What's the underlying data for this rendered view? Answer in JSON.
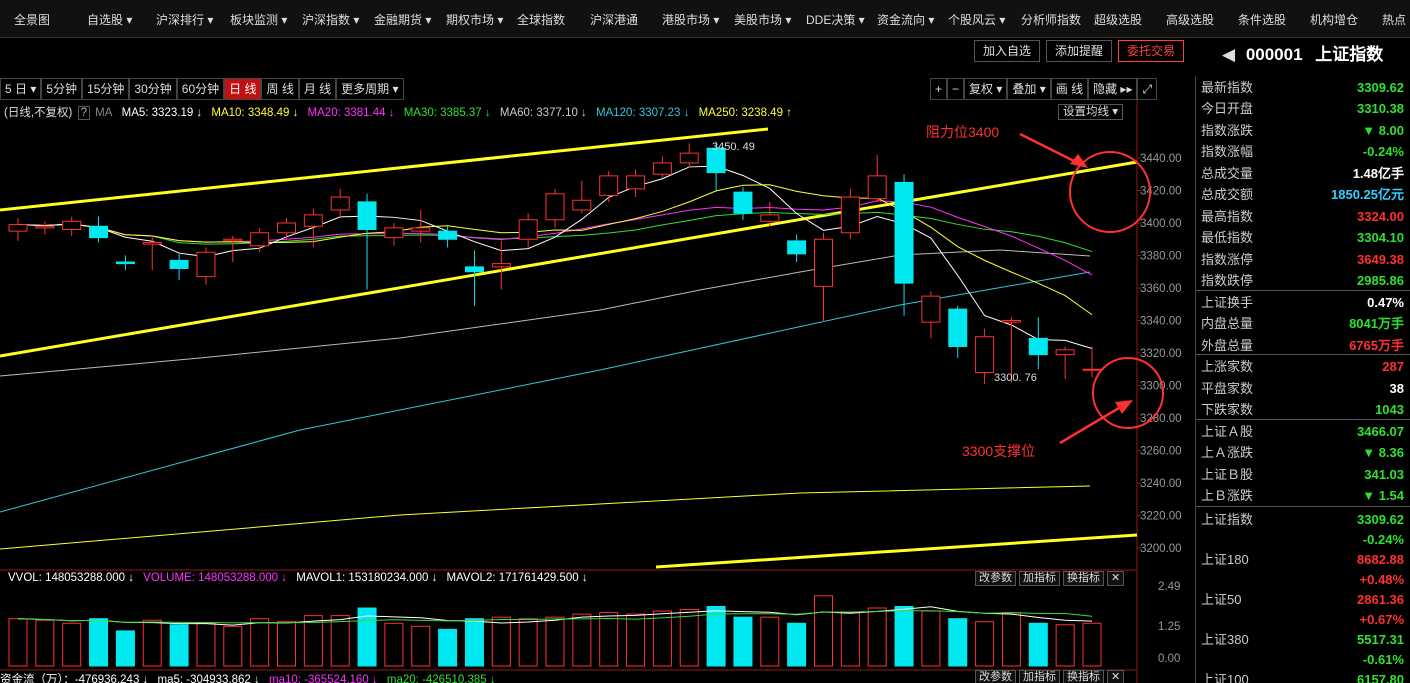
{
  "nav": [
    "全景图",
    "自选股 ▾",
    "沪深排行 ▾",
    "板块监测 ▾",
    "沪深指数 ▾",
    "金融期货 ▾",
    "期权市场 ▾",
    "全球指数",
    "沪深港通",
    "港股市场 ▾",
    "美股市场 ▾",
    "DDE决策 ▾",
    "资金流向 ▾",
    "个股风云 ▾",
    "分析师指数",
    "超级选股",
    "高级选股",
    "条件选股",
    "机构增仓",
    "热点"
  ],
  "actions": {
    "add_watch": "加入自选",
    "add_alert": "添加提醒",
    "trade": "委托交易"
  },
  "stock": {
    "code": "000001",
    "name": "上证指数"
  },
  "periods": [
    "5 日 ▾",
    "5分钟",
    "15分钟",
    "30分钟",
    "60分钟",
    "日 线",
    "周 线",
    "月 线",
    "更多周期 ▾"
  ],
  "tools": [
    "+",
    "−",
    "复权 ▾",
    "叠加 ▾",
    "画 线",
    "隐藏 ▸▸",
    "⤢"
  ],
  "ma_labels": {
    "mode": "(日线,不复权)",
    "q": "?",
    "ma": "MA",
    "ma5": "MA5: 3323.19 ↓",
    "ma10": "MA10: 3348.49 ↓",
    "ma20": "MA20: 3381.44 ↓",
    "ma30": "MA30: 3385.37 ↓",
    "ma60": "MA60: 3377.10 ↓",
    "ma120": "MA120: 3307.23 ↓",
    "ma250": "MA250: 3238.49 ↑",
    "setma": "设置均线 ▾"
  },
  "colors": {
    "up": "#ff3030",
    "down": "#00e8f0",
    "ma5": "#ffffff",
    "ma10": "#ffff30",
    "ma20": "#ff30ff",
    "ma30": "#30e030",
    "ma60": "#bbbbbb",
    "ma120": "#30c8e0",
    "ma250": "#ffff30",
    "trend": "#ffff20",
    "annot": "#ff3030"
  },
  "price_axis": [
    "3440.00",
    "3420.00",
    "3400.00",
    "3380.00",
    "3360.00",
    "3340.00",
    "3320.00",
    "3300.00",
    "3280.00",
    "3260.00",
    "3240.00",
    "3220.00",
    "3200.00"
  ],
  "high_label": "3450. 49",
  "low_label": "3300. 76",
  "annotations": {
    "resistance": "阻力位3400",
    "support": "3300支撑位"
  },
  "candles": [
    {
      "o": 3395,
      "c": 3399,
      "h": 3403,
      "l": 3389
    },
    {
      "o": 3397,
      "c": 3398,
      "h": 3401,
      "l": 3393
    },
    {
      "o": 3396,
      "c": 3401,
      "h": 3404,
      "l": 3392
    },
    {
      "o": 3398,
      "c": 3391,
      "h": 3404,
      "l": 3388
    },
    {
      "o": 3376,
      "c": 3375,
      "h": 3380,
      "l": 3371
    },
    {
      "o": 3387,
      "c": 3388,
      "h": 3392,
      "l": 3371
    },
    {
      "o": 3377,
      "c": 3372,
      "h": 3381,
      "l": 3365
    },
    {
      "o": 3367,
      "c": 3382,
      "h": 3385,
      "l": 3362
    },
    {
      "o": 3389,
      "c": 3390,
      "h": 3392,
      "l": 3376
    },
    {
      "o": 3386,
      "c": 3394,
      "h": 3397,
      "l": 3382
    },
    {
      "o": 3394,
      "c": 3400,
      "h": 3403,
      "l": 3390
    },
    {
      "o": 3398,
      "c": 3405,
      "h": 3409,
      "l": 3385
    },
    {
      "o": 3408,
      "c": 3416,
      "h": 3421,
      "l": 3403
    },
    {
      "o": 3413,
      "c": 3396,
      "h": 3418,
      "l": 3359
    },
    {
      "o": 3391,
      "c": 3397,
      "h": 3400,
      "l": 3386
    },
    {
      "o": 3395,
      "c": 3397,
      "h": 3408,
      "l": 3388
    },
    {
      "o": 3395,
      "c": 3390,
      "h": 3398,
      "l": 3385
    },
    {
      "o": 3373,
      "c": 3370,
      "h": 3383,
      "l": 3349
    },
    {
      "o": 3373,
      "c": 3375,
      "h": 3389,
      "l": 3359
    },
    {
      "o": 3390,
      "c": 3402,
      "h": 3406,
      "l": 3385
    },
    {
      "o": 3402,
      "c": 3418,
      "h": 3421,
      "l": 3397
    },
    {
      "o": 3408,
      "c": 3414,
      "h": 3426,
      "l": 3406
    },
    {
      "o": 3417,
      "c": 3429,
      "h": 3432,
      "l": 3413
    },
    {
      "o": 3421,
      "c": 3429,
      "h": 3433,
      "l": 3416
    },
    {
      "o": 3430,
      "c": 3437,
      "h": 3441,
      "l": 3428
    },
    {
      "o": 3437,
      "c": 3443,
      "h": 3449,
      "l": 3434
    },
    {
      "o": 3446,
      "c": 3431,
      "h": 3450,
      "l": 3420
    },
    {
      "o": 3419,
      "c": 3406,
      "h": 3422,
      "l": 3402
    },
    {
      "o": 3401,
      "c": 3405,
      "h": 3413,
      "l": 3398
    },
    {
      "o": 3389,
      "c": 3381,
      "h": 3393,
      "l": 3376
    },
    {
      "o": 3361,
      "c": 3390,
      "h": 3394,
      "l": 3339
    },
    {
      "o": 3394,
      "c": 3416,
      "h": 3421,
      "l": 3390
    },
    {
      "o": 3415,
      "c": 3429,
      "h": 3442,
      "l": 3413
    },
    {
      "o": 3425,
      "c": 3363,
      "h": 3430,
      "l": 3343
    },
    {
      "o": 3339,
      "c": 3355,
      "h": 3358,
      "l": 3329
    },
    {
      "o": 3347,
      "c": 3324,
      "h": 3349,
      "l": 3317
    },
    {
      "o": 3308,
      "c": 3330,
      "h": 3335,
      "l": 3301
    },
    {
      "o": 3339,
      "c": 3340,
      "h": 3342,
      "l": 3302
    },
    {
      "o": 3329,
      "c": 3319,
      "h": 3342,
      "l": 3310
    },
    {
      "o": 3319,
      "c": 3322,
      "h": 3324,
      "l": 3304
    },
    {
      "o": 3310,
      "c": 3310,
      "h": 3324,
      "l": 3305
    }
  ],
  "vol_labels": {
    "vvol": "VVOL: 148053288.000 ↓",
    "volume": "VOLUME: 148053288.000 ↓",
    "mavol1": "MAVOL1: 153180234.000 ↓",
    "mavol2": "MAVOL2: 171761429.500 ↓",
    "axis": [
      "2.49",
      "1.25",
      "0.00"
    ]
  },
  "volumes": [
    1.55,
    1.5,
    1.4,
    1.55,
    1.15,
    1.5,
    1.35,
    1.4,
    1.3,
    1.55,
    1.45,
    1.65,
    1.65,
    1.9,
    1.4,
    1.3,
    1.2,
    1.55,
    1.6,
    1.55,
    1.6,
    1.7,
    1.75,
    1.7,
    1.8,
    1.85,
    1.95,
    1.6,
    1.6,
    1.4,
    2.3,
    1.75,
    1.9,
    1.95,
    1.8,
    1.55,
    1.45,
    1.75,
    1.4,
    1.35,
    1.4
  ],
  "small_buttons": [
    "改参数",
    "加指标",
    "换指标",
    "✕"
  ],
  "flow_labels": {
    "label": "资金流（万）：-476936.243 ↓",
    "ma5": "ma5: -304933.862 ↓",
    "ma10": "ma10: -365524.160 ↓",
    "ma20": "ma20: -426510.385 ↓"
  },
  "panel": [
    {
      "label": "最新指数",
      "value": "3309.62",
      "color": "#30e030"
    },
    {
      "label": "今日开盘",
      "value": "3310.38",
      "color": "#30e030"
    },
    {
      "label": "指数涨跌",
      "value": "▼ 8.00",
      "color": "#30e030"
    },
    {
      "label": "指数涨幅",
      "value": "-0.24%",
      "color": "#30e030"
    },
    {
      "label": "总成交量",
      "value": "1.48亿手",
      "color": "#ffffff"
    },
    {
      "label": "总成交额",
      "value": "1850.25亿元",
      "color": "#30d0ff"
    },
    {
      "label": "最高指数",
      "value": "3324.00",
      "color": "#ff3030"
    },
    {
      "label": "最低指数",
      "value": "3304.10",
      "color": "#30e030"
    },
    {
      "label": "指数涨停",
      "value": "3649.38",
      "color": "#ff3030"
    },
    {
      "label": "指数跌停",
      "value": "2985.86",
      "color": "#30e030"
    },
    {
      "label": "上证换手",
      "value": "0.47%",
      "color": "#ffffff"
    },
    {
      "label": "内盘总量",
      "value": "8041万手",
      "color": "#30e030"
    },
    {
      "label": "外盘总量",
      "value": "6765万手",
      "color": "#ff3030"
    },
    {
      "label": "上涨家数",
      "value": "287",
      "color": "#ff3030"
    },
    {
      "label": "平盘家数",
      "value": "38",
      "color": "#ffffff"
    },
    {
      "label": "下跌家数",
      "value": "1043",
      "color": "#30e030"
    },
    {
      "label": "上证Ａ股",
      "value": "3466.07",
      "color": "#30e030"
    },
    {
      "label": "上Ａ涨跌",
      "value": "▼ 8.36",
      "color": "#30e030"
    },
    {
      "label": "上证Ｂ股",
      "value": "341.03",
      "color": "#30e030"
    },
    {
      "label": "上Ｂ涨跌",
      "value": "▼ 1.54",
      "color": "#30e030"
    }
  ],
  "indices": [
    {
      "name": "上证指数",
      "value": "3309.62",
      "change": "-0.24%",
      "vcolor": "#30e030",
      "ccolor": "#30e030"
    },
    {
      "name": "上证180",
      "value": "8682.88",
      "change": "+0.48%",
      "vcolor": "#ff3030",
      "ccolor": "#ff3030"
    },
    {
      "name": "上证50",
      "value": "2861.36",
      "change": "+0.67%",
      "vcolor": "#ff3030",
      "ccolor": "#ff3030"
    },
    {
      "name": "上证380",
      "value": "5517.31",
      "change": "-0.61%",
      "vcolor": "#30e030",
      "ccolor": "#30e030"
    },
    {
      "name": "上证100",
      "value": "6157.80",
      "change": "",
      "vcolor": "#30e030",
      "ccolor": "#30e030"
    }
  ]
}
